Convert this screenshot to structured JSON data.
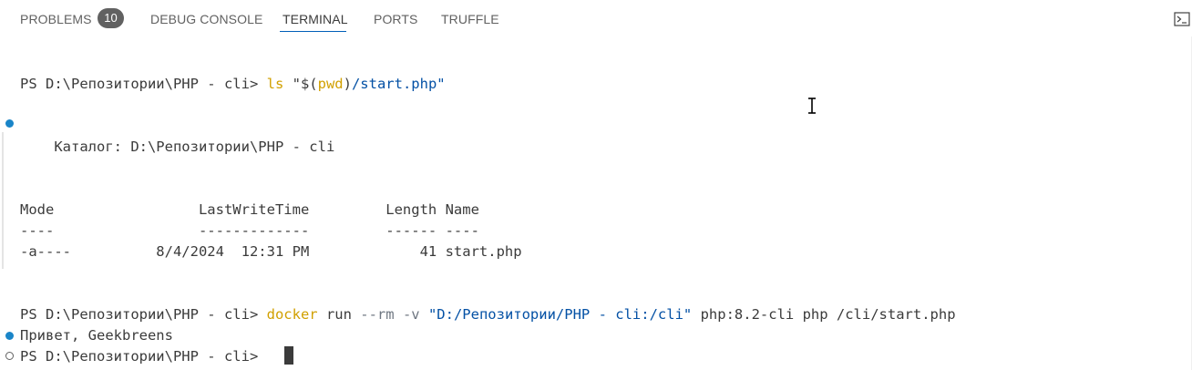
{
  "tabs": [
    {
      "label": "PROBLEMS",
      "badge": "10"
    },
    {
      "label": "DEBUG CONSOLE"
    },
    {
      "label": "TERMINAL",
      "active": true
    },
    {
      "label": "PORTS"
    },
    {
      "label": "TRUFFLE"
    }
  ],
  "terminal": {
    "line1": {
      "prompt": "PS D:\\Репозитории\\PHP - cli> ",
      "cmd": "ls",
      "arg_open": " \"$(",
      "arg_var": "pwd",
      "arg_close": ")",
      "arg_tail": "/start.php\""
    },
    "catalog": "    Каталог: D:\\Репозитории\\PHP - cli",
    "header": "Mode                 LastWriteTime         Length Name",
    "separator": "----                 -------------         ------ ----",
    "row": "-a----          8/4/2024  12:31 PM             41 start.php",
    "line2": {
      "prompt": "PS D:\\Репозитории\\PHP - cli> ",
      "cmd": "docker",
      "sub": " run ",
      "flags": "--rm -v ",
      "str": "\"D:/Репозитории/PHP - cli:/cli\"",
      "rest": " php:8.2-cli php /cli/start.php"
    },
    "output": "Привет, Geekbreens",
    "line3": {
      "prompt": "PS D:\\Репозитории\\PHP - cli> "
    }
  },
  "colors": {
    "accent": "#005fb8",
    "badge_bg": "#616161",
    "decoration_success": "#1a85c8",
    "command": "#795e26",
    "string": "#0451a5"
  },
  "icons": {
    "shell": "terminal-shell-icon",
    "mouse": "text-cursor-icon"
  }
}
